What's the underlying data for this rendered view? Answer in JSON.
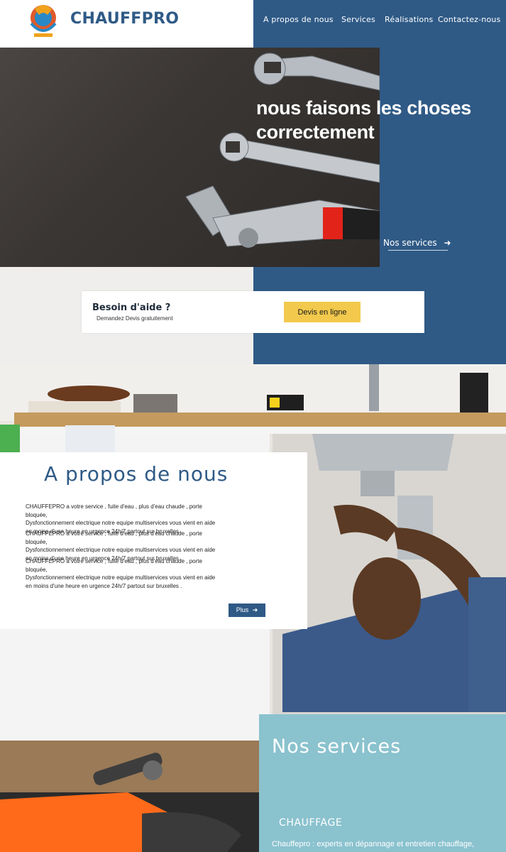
{
  "header": {
    "brand": "CHAUFFPRO",
    "nav": [
      "A propos de nous",
      "Services",
      "Réalisations",
      "Contactez-nous"
    ]
  },
  "hero": {
    "title": "nous faisons les choses correctement",
    "link": "Nos services",
    "image_icon": "wrenches-image"
  },
  "help": {
    "title": "Besoin d'aide ?",
    "subtitle": "Demandez Devis gratuitement",
    "button": "Devis en ligne"
  },
  "about": {
    "title": "A propos de nous",
    "paragraphs": [
      [
        "CHAUFFEPRO a votre service , fuite d'eau , plus d'eau chaude , porte bloquée,",
        "Dysfonctionnement electrique  notre equipe multiservices vous vient en aide",
        "en moins d'une heure en urgence 24h/7 partout sur bruxelles ."
      ],
      [
        "CHAUFFEPRO a votre service , fuite d'eau , plus d'eau chaude , porte bloquée,",
        "Dysfonctionnement electrique  notre equipe multiservices vous vient en aide",
        "en moins d'une heure en urgence 24h/7 partout sur bruxelles ."
      ],
      [
        "CHAUFFEPRO a votre service , fuite d'eau , plus d'eau chaude , porte bloquée,",
        "Dysfonctionnement electrique  notre equipe multiservices vous vient en aide",
        "en moins d'une heure en urgence 24h/7 partout sur bruxelles ."
      ]
    ],
    "button": "Plus"
  },
  "services": {
    "title": "Nos services",
    "item_name": "CHAUFFAGE",
    "item_desc": "Chauffepro : experts en dépannage et entretien chauffage,"
  },
  "colors": {
    "primary": "#2f5a86",
    "accent": "#f2c94c",
    "services_bg": "#8ac2ce"
  }
}
